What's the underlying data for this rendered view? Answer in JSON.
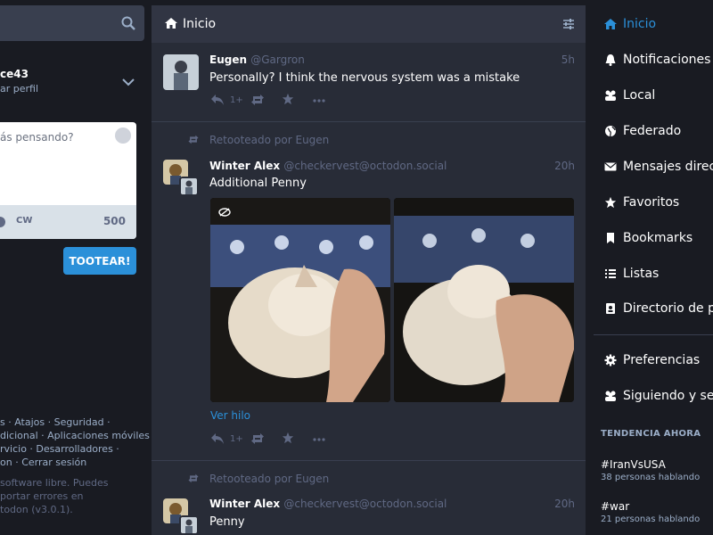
{
  "compose": {
    "profile_name": "ce43",
    "profile_sub": "ar perfil",
    "placeholder": "ás pensando?",
    "cw": "CW",
    "char_count": "500",
    "toot": "TOOTEAR!"
  },
  "footer": {
    "lines": [
      "s · Atajos · Seguridad ·",
      "dicional · Aplicaciones móviles ·",
      "rvicio · Desarrolladores ·",
      "on · Cerrar sesión"
    ],
    "about_lines": [
      "software libre. Puedes",
      "portar errores en",
      "todon (v3.0.1)."
    ]
  },
  "column": {
    "title": "Inicio"
  },
  "statuses": [
    {
      "name": "Eugen",
      "handle": "@Gargron",
      "time": "5h",
      "content": "Personally? I think the nervous system was a mistake",
      "reply_count": "1+"
    },
    {
      "rt_prefix": "Retooteado por Eugen",
      "name": "Winter Alex",
      "handle": "@checkervest@octodon.social",
      "time": "20h",
      "content": "Additional Penny",
      "show_thread": "Ver hilo",
      "reply_count": "1+"
    },
    {
      "rt_prefix": "Retooteado por Eugen",
      "name": "Winter Alex",
      "handle": "@checkervest@octodon.social",
      "time": "20h",
      "content": "Penny"
    }
  ],
  "nav": {
    "items": [
      {
        "label": "Inicio",
        "icon": "home-icon",
        "active": true
      },
      {
        "label": "Notificaciones",
        "icon": "bell-icon"
      },
      {
        "label": "Local",
        "icon": "users-icon"
      },
      {
        "label": "Federado",
        "icon": "globe-icon"
      },
      {
        "label": "Mensajes directo",
        "icon": "envelope-icon"
      },
      {
        "label": "Favoritos",
        "icon": "star-icon"
      },
      {
        "label": "Bookmarks",
        "icon": "bookmark-icon"
      },
      {
        "label": "Listas",
        "icon": "list-icon"
      },
      {
        "label": "Directorio de perf",
        "icon": "address-book-icon"
      },
      {
        "label": "Preferencias",
        "icon": "gear-icon"
      },
      {
        "label": "Siguiendo y segu",
        "icon": "users-icon"
      }
    ]
  },
  "trending": {
    "label": "TENDENCIA AHORA",
    "tags": [
      {
        "tag": "#IranVsUSA",
        "count": "38 personas hablando"
      },
      {
        "tag": "#war",
        "count": "21 personas hablando"
      }
    ]
  },
  "colors": {
    "accent": "#2b90d9",
    "background": "#191b22",
    "column": "#282c37",
    "muted": "#606984",
    "secondary_text": "#9baec8"
  }
}
